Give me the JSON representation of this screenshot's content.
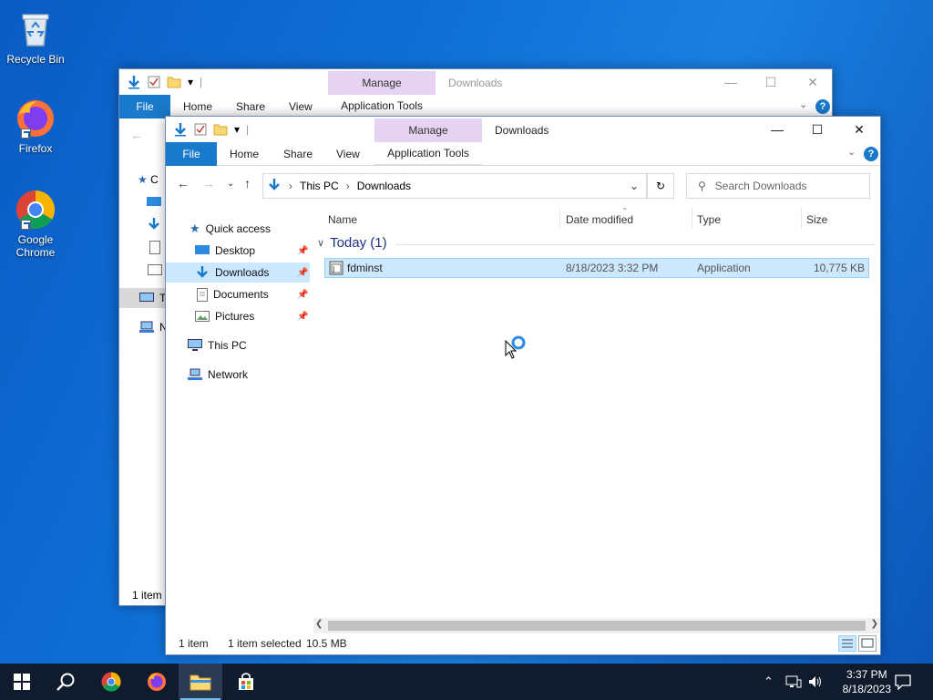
{
  "desktop": {
    "icons": [
      {
        "label": "Recycle Bin"
      },
      {
        "label": "Firefox"
      },
      {
        "label": "Google Chrome"
      }
    ]
  },
  "back_window": {
    "title": "Downloads",
    "manage_label": "Manage",
    "app_tools_label": "Application Tools",
    "tabs": {
      "file": "File",
      "home": "Home",
      "share": "Share",
      "view": "View"
    },
    "status": "1 item",
    "nav_partials": [
      "C",
      "T",
      "N"
    ]
  },
  "front_window": {
    "title": "Downloads",
    "manage_label": "Manage",
    "app_tools_label": "Application Tools",
    "tabs": {
      "file": "File",
      "home": "Home",
      "share": "Share",
      "view": "View"
    },
    "breadcrumb": [
      "This PC",
      "Downloads"
    ],
    "search_placeholder": "Search Downloads",
    "nav": {
      "quick_access": "Quick access",
      "desktop": "Desktop",
      "downloads": "Downloads",
      "documents": "Documents",
      "pictures": "Pictures",
      "this_pc": "This PC",
      "network": "Network"
    },
    "columns": {
      "name": "Name",
      "date": "Date modified",
      "type": "Type",
      "size": "Size"
    },
    "group": "Today (1)",
    "files": [
      {
        "name": "fdminst",
        "date": "8/18/2023 3:32 PM",
        "type": "Application",
        "size": "10,775 KB"
      }
    ],
    "status": {
      "count": "1 item",
      "selected": "1 item selected",
      "size": "10.5 MB"
    }
  },
  "taskbar": {
    "time": "3:37 PM",
    "date": "8/18/2023"
  },
  "colors": {
    "accent": "#1979ca",
    "manage_tab": "#e6d3f2",
    "selection": "#cce8ff",
    "taskbar": "#101c2e"
  }
}
